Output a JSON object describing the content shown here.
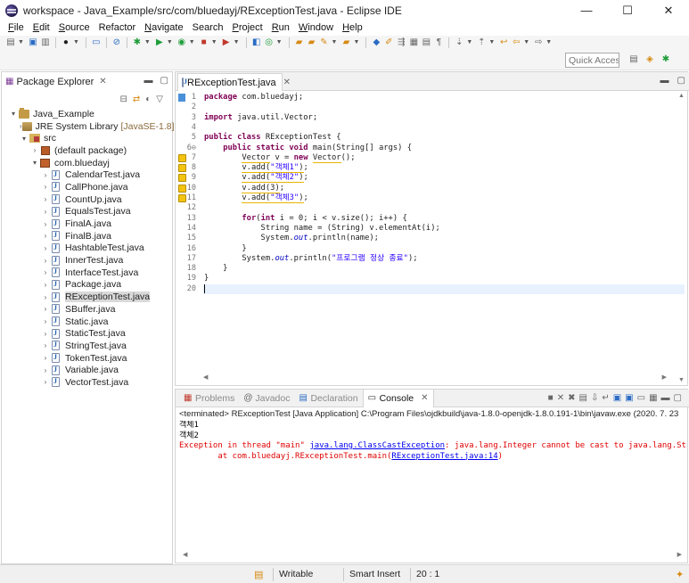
{
  "window": {
    "title": "workspace - Java_Example/src/com/bluedayj/RExceptionTest.java - Eclipse IDE",
    "minimize": "—",
    "maximize": "☐",
    "close": "✕"
  },
  "menu": [
    {
      "label": "File",
      "u": "F",
      "rest": "ile"
    },
    {
      "label": "Edit",
      "u": "E",
      "rest": "dit"
    },
    {
      "label": "Source",
      "u": "S",
      "rest": "ource"
    },
    {
      "label": "Refactor",
      "u": "",
      "rest": "Refactor"
    },
    {
      "label": "Navigate",
      "u": "N",
      "rest": "avigate"
    },
    {
      "label": "Search",
      "u": "",
      "rest": "Search"
    },
    {
      "label": "Project",
      "u": "P",
      "rest": "roject"
    },
    {
      "label": "Run",
      "u": "R",
      "rest": "un"
    },
    {
      "label": "Window",
      "u": "W",
      "rest": "indow"
    },
    {
      "label": "Help",
      "u": "H",
      "rest": "elp"
    }
  ],
  "quick_access": {
    "placeholder": "Quick Access"
  },
  "package_explorer": {
    "title": "Package Explorer",
    "items": [
      {
        "label": "Java_Example",
        "decor": "",
        "indent": 0,
        "twisty": "▾",
        "icon": "proj"
      },
      {
        "label": "JRE System Library",
        "decor": "[JavaSE-1.8]",
        "indent": 1,
        "twisty": "›",
        "icon": "lib"
      },
      {
        "label": "src",
        "decor": "",
        "indent": 1,
        "twisty": "▾",
        "icon": "src"
      },
      {
        "label": "(default package)",
        "decor": "",
        "indent": 2,
        "twisty": "›",
        "icon": "pkg"
      },
      {
        "label": "com.bluedayj",
        "decor": "",
        "indent": 2,
        "twisty": "▾",
        "icon": "pkg-open"
      },
      {
        "label": "CalendarTest.java",
        "decor": "",
        "indent": 3,
        "twisty": "›",
        "icon": "java"
      },
      {
        "label": "CallPhone.java",
        "decor": "",
        "indent": 3,
        "twisty": "›",
        "icon": "java"
      },
      {
        "label": "CountUp.java",
        "decor": "",
        "indent": 3,
        "twisty": "›",
        "icon": "java"
      },
      {
        "label": "EqualsTest.java",
        "decor": "",
        "indent": 3,
        "twisty": "›",
        "icon": "java"
      },
      {
        "label": "FinalA.java",
        "decor": "",
        "indent": 3,
        "twisty": "›",
        "icon": "java"
      },
      {
        "label": "FinalB.java",
        "decor": "",
        "indent": 3,
        "twisty": "›",
        "icon": "java"
      },
      {
        "label": "HashtableTest.java",
        "decor": "",
        "indent": 3,
        "twisty": "›",
        "icon": "java"
      },
      {
        "label": "InnerTest.java",
        "decor": "",
        "indent": 3,
        "twisty": "›",
        "icon": "java"
      },
      {
        "label": "InterfaceTest.java",
        "decor": "",
        "indent": 3,
        "twisty": "›",
        "icon": "java"
      },
      {
        "label": "Package.java",
        "decor": "",
        "indent": 3,
        "twisty": "›",
        "icon": "java"
      },
      {
        "label": "RExceptionTest.java",
        "decor": "",
        "indent": 3,
        "twisty": "›",
        "icon": "java",
        "selected": true
      },
      {
        "label": "SBuffer.java",
        "decor": "",
        "indent": 3,
        "twisty": "›",
        "icon": "java"
      },
      {
        "label": "Static.java",
        "decor": "",
        "indent": 3,
        "twisty": "›",
        "icon": "java"
      },
      {
        "label": "StaticTest.java",
        "decor": "",
        "indent": 3,
        "twisty": "›",
        "icon": "java"
      },
      {
        "label": "StringTest.java",
        "decor": "",
        "indent": 3,
        "twisty": "›",
        "icon": "java"
      },
      {
        "label": "TokenTest.java",
        "decor": "",
        "indent": 3,
        "twisty": "›",
        "icon": "java"
      },
      {
        "label": "Variable.java",
        "decor": "",
        "indent": 3,
        "twisty": "›",
        "icon": "java"
      },
      {
        "label": "VectorTest.java",
        "decor": "",
        "indent": 3,
        "twisty": "›",
        "icon": "java"
      }
    ]
  },
  "editor": {
    "tab_label": "RExceptionTest.java",
    "lines": [
      {
        "n": "1",
        "mark": "bp",
        "html": "<span class='kw'>package</span> com.bluedayj;"
      },
      {
        "n": "2",
        "mark": "",
        "html": ""
      },
      {
        "n": "3",
        "mark": "",
        "html": "<span class='kw'>import</span> java.util.Vector;"
      },
      {
        "n": "4",
        "mark": "",
        "html": ""
      },
      {
        "n": "5",
        "mark": "",
        "html": "<span class='kw'>public class</span> RExceptionTest {"
      },
      {
        "n": "6⊖",
        "mark": "",
        "html": "    <span class='kw'>public static void</span> main(String[] args) {"
      },
      {
        "n": "7",
        "mark": "warn",
        "html": "        <span class='warn-ul'>Vector</span> v = <span class='kw'>new</span> <span class='warn-ul'>Vector</span>();"
      },
      {
        "n": "8",
        "mark": "warn",
        "html": "        <span class='warn-ul'>v.add(<span class='str'>\"객체1\"</span>)</span>;"
      },
      {
        "n": "9",
        "mark": "warn",
        "html": "        <span class='warn-ul'>v.add(<span class='str'>\"객체2\"</span>)</span>;"
      },
      {
        "n": "10",
        "mark": "warn",
        "html": "        <span class='warn-ul'>v.add(3)</span>;"
      },
      {
        "n": "11",
        "mark": "warn",
        "html": "        <span class='warn-ul'>v.add(<span class='str'>\"객체3\"</span>)</span>;"
      },
      {
        "n": "12",
        "mark": "",
        "html": ""
      },
      {
        "n": "13",
        "mark": "",
        "html": "        <span class='kw'>for</span>(<span class='kw'>int</span> i = 0; i &lt; v.size(); i++) {"
      },
      {
        "n": "14",
        "mark": "",
        "html": "            String name = (String) v.elementAt(i);"
      },
      {
        "n": "15",
        "mark": "",
        "html": "            System.<span class='fld'>out</span>.println(name);"
      },
      {
        "n": "16",
        "mark": "",
        "html": "        }"
      },
      {
        "n": "17",
        "mark": "",
        "html": "        System.<span class='fld'>out</span>.println(<span class='str'>\"프로그램 정상 종료\"</span>);"
      },
      {
        "n": "18",
        "mark": "",
        "html": "    }"
      },
      {
        "n": "19",
        "mark": "",
        "html": "}"
      },
      {
        "n": "20",
        "mark": "",
        "html": "<span class='caret'></span>",
        "current": true
      }
    ]
  },
  "console": {
    "tabs": [
      {
        "label": "Problems",
        "active": false,
        "icon": "problems"
      },
      {
        "label": "Javadoc",
        "active": false,
        "icon": "javadoc"
      },
      {
        "label": "Declaration",
        "active": false,
        "icon": "declaration"
      },
      {
        "label": "Console",
        "active": true,
        "icon": "console"
      }
    ],
    "status": "<terminated> RExceptionTest [Java Application] C:\\Program Files\\ojdkbuild\\java-1.8.0-openjdk-1.8.0.191-1\\bin\\javaw.exe (2020. 7. 23",
    "output": [
      {
        "kind": "norm",
        "html": "객체1"
      },
      {
        "kind": "norm",
        "html": "객체2"
      },
      {
        "kind": "err",
        "html": "Exception in thread \"main\" <span class='out-link'>java.lang.ClassCastException</span>: java.lang.Integer cannot be cast to java.lang.St"
      },
      {
        "kind": "err",
        "html": "\tat com.bluedayj.RExceptionTest.main(<span class='out-link'>RExceptionTest.java:14</span>)"
      }
    ]
  },
  "statusbar": {
    "writable": "Writable",
    "insert_mode": "Smart Insert",
    "position": "20 : 1"
  },
  "colors": {
    "keyword": "#7f0055",
    "string": "#2a00ff",
    "error": "#e00000",
    "link": "#0000ee"
  }
}
